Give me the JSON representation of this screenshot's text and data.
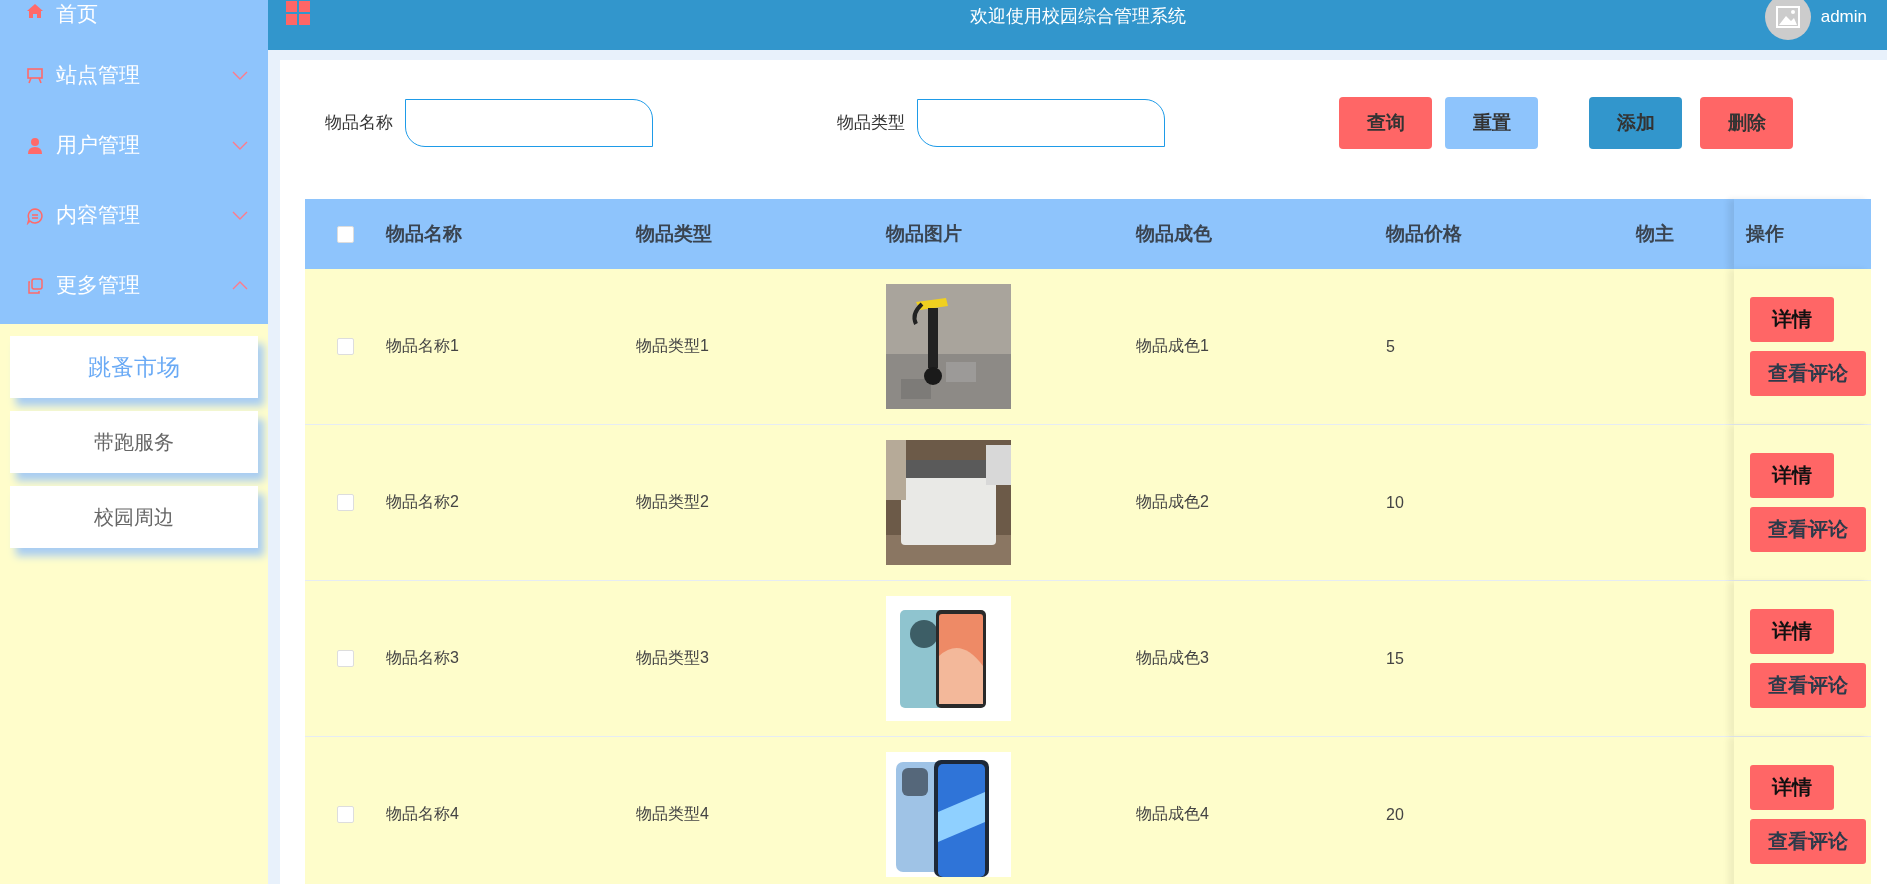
{
  "topbar": {
    "title": "欢迎使用校园综合管理系统",
    "user": "admin"
  },
  "sidebar": {
    "items": [
      {
        "label": "首页",
        "has_children": false
      },
      {
        "label": "站点管理",
        "expanded": false,
        "has_children": true
      },
      {
        "label": "用户管理",
        "expanded": false,
        "has_children": true
      },
      {
        "label": "内容管理",
        "expanded": false,
        "has_children": true
      },
      {
        "label": "更多管理",
        "expanded": true,
        "has_children": true,
        "children": [
          {
            "label": "跳蚤市场",
            "selected": true
          },
          {
            "label": "带跑服务",
            "selected": false
          },
          {
            "label": "校园周边",
            "selected": false
          }
        ]
      }
    ]
  },
  "search": {
    "fields": [
      {
        "label": "物品名称"
      },
      {
        "label": "物品类型"
      }
    ],
    "buttons": [
      {
        "label": "查询",
        "color": "#ff6666"
      },
      {
        "label": "重置",
        "color": "#8ec4fc"
      },
      {
        "label": "添加",
        "color": "#3296cc"
      },
      {
        "label": "删除",
        "color": "#ff6666"
      }
    ]
  },
  "table": {
    "select_all": {
      "checked": false
    },
    "columns": [
      "物品名称",
      "物品类型",
      "物品图片",
      "物品成色",
      "物品价格",
      "物主",
      "操作"
    ],
    "rows": [
      {
        "checked": false,
        "name": "物品名称1",
        "type": "物品类型1",
        "image": {
          "kind": "picture"
        },
        "condition": "物品成色1",
        "price": "5",
        "actions": [
          "详情",
          "查看评论"
        ]
      },
      {
        "checked": false,
        "name": "物品名称2",
        "type": "物品类型2",
        "image": {
          "kind": "picture"
        },
        "condition": "物品成色2",
        "price": "10",
        "actions": [
          "详情",
          "查看评论"
        ]
      },
      {
        "checked": false,
        "name": "物品名称3",
        "type": "物品类型3",
        "image": {
          "kind": "picture"
        },
        "condition": "物品成色3",
        "price": "15",
        "actions": [
          "详情",
          "查看评论"
        ]
      },
      {
        "checked": false,
        "name": "物品名称4",
        "type": "物品类型4",
        "image": {
          "kind": "picture"
        },
        "condition": "物品成色4",
        "price": "20",
        "actions": [
          "详情",
          "查看评论"
        ]
      }
    ]
  }
}
